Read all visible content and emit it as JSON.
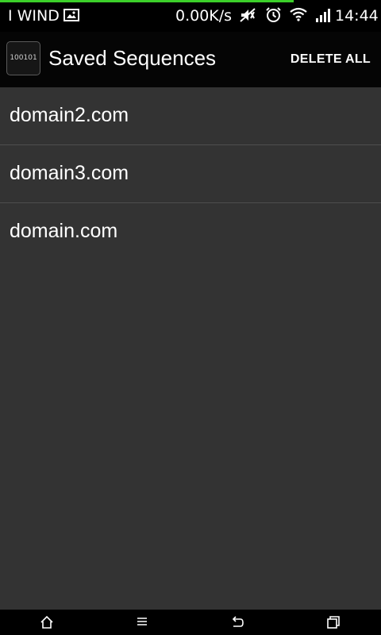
{
  "status_bar": {
    "carrier": "I WIND",
    "network_speed": "0.00K/s",
    "time": "14:44",
    "progress_fraction": 0.77,
    "icons": [
      "image-icon",
      "muted-icon",
      "alarm-icon",
      "wifi-icon",
      "signal-icon"
    ]
  },
  "action_bar": {
    "app_icon_text": "100101",
    "title": "Saved Sequences",
    "delete_all_label": "DELETE ALL"
  },
  "sequences": [
    {
      "label": "domain2.com"
    },
    {
      "label": "domain3.com"
    },
    {
      "label": "domain.com"
    }
  ],
  "nav_bar": {
    "icons": [
      "home-icon",
      "menu-icon",
      "back-icon",
      "recent-apps-icon"
    ]
  },
  "colors": {
    "background": "#333333",
    "action_bar": "#050505",
    "status_bar": "#000000",
    "progress": "#3ccf2a",
    "divider": "#4e4e4e",
    "text": "#ffffff"
  }
}
